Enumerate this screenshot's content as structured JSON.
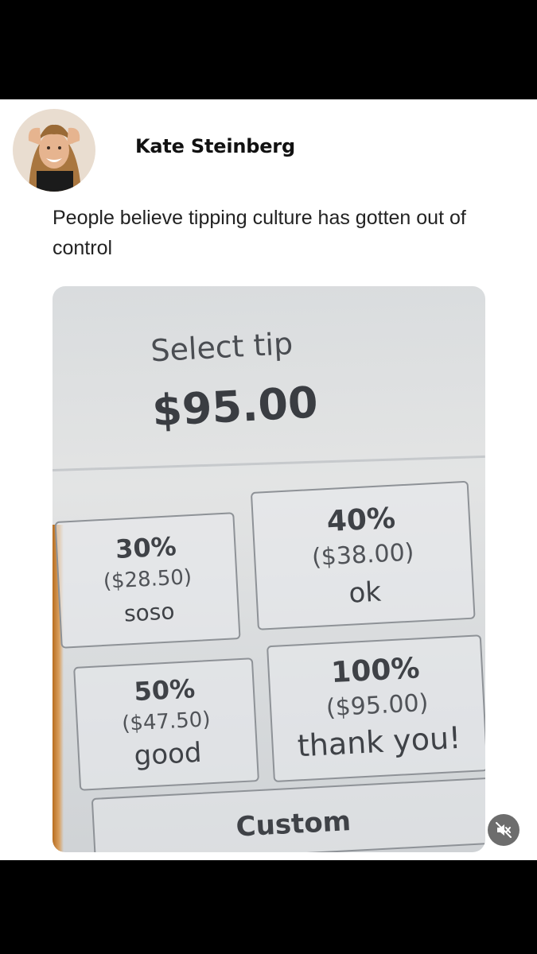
{
  "post": {
    "author": "Kate Steinberg",
    "text": "People believe tipping culture has gotten out of control"
  },
  "photo": {
    "title": "Select tip",
    "total": "$95.00",
    "tip_options": [
      {
        "percent": "30%",
        "amount": "($28.50)",
        "label": "soso"
      },
      {
        "percent": "40%",
        "amount": "($38.00)",
        "label": "ok"
      },
      {
        "percent": "50%",
        "amount": "($47.50)",
        "label": "good"
      },
      {
        "percent": "100%",
        "amount": "($95.00)",
        "label": "thank you!"
      }
    ],
    "custom_label": "Custom"
  },
  "controls": {
    "mute_icon": "speaker-muted-icon"
  },
  "colors": {
    "post_background": "#ffffff",
    "letterbox": "#000000",
    "screen_text": "#3f4247"
  }
}
